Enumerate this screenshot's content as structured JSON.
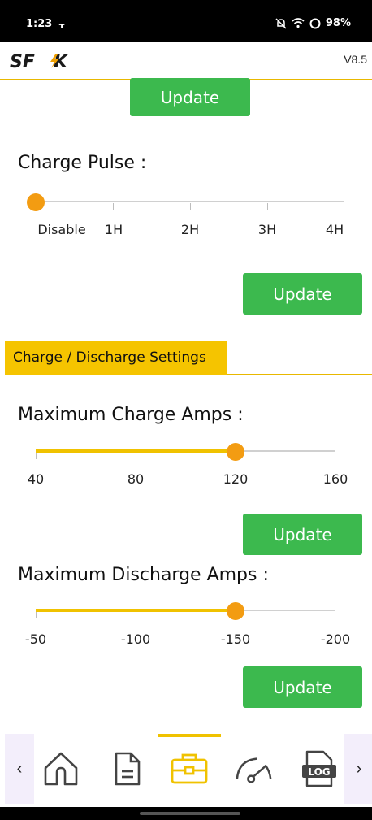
{
  "status_bar": {
    "time": "1:23",
    "time_icon": "usb-icon",
    "battery": "98%",
    "icons": [
      "bell-off-icon",
      "wifi-icon",
      "battery-ring-icon"
    ]
  },
  "header": {
    "logo": "SFK",
    "version": "V8.5"
  },
  "top_update": {
    "label": "Update"
  },
  "charge_pulse": {
    "title": "Charge Pulse :",
    "options": [
      "Disable",
      "1H",
      "2H",
      "3H",
      "4H"
    ],
    "selected": "Disable",
    "update_label": "Update"
  },
  "section": {
    "title": "Charge / Discharge Settings"
  },
  "max_charge": {
    "title": "Maximum Charge Amps :",
    "ticks": [
      "40",
      "80",
      "120",
      "160"
    ],
    "value": "120",
    "update_label": "Update"
  },
  "max_discharge": {
    "title": "Maximum Discharge Amps :",
    "ticks": [
      "-50",
      "-100",
      "-150",
      "-200"
    ],
    "value": "-150",
    "update_label": "Update"
  },
  "bottom_nav": {
    "items": [
      "home-icon",
      "document-icon",
      "toolbox-icon",
      "gauge-icon",
      "log-icon"
    ],
    "log_text": "LOG",
    "active": "toolbox-icon",
    "prev": "‹",
    "next": "›"
  },
  "colors": {
    "accent": "#f5c400",
    "button": "#3cb94e",
    "thumb": "#f39c12"
  }
}
